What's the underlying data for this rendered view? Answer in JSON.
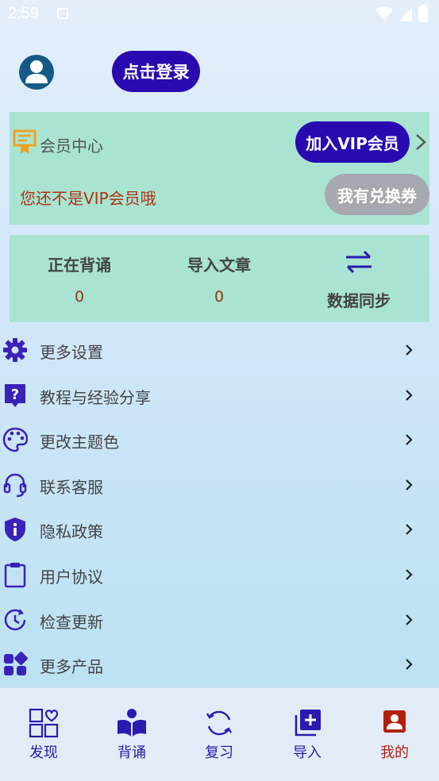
{
  "status_bar": {
    "time": "2:59"
  },
  "profile": {
    "login_label": "点击登录"
  },
  "vip": {
    "title": "会员中心",
    "join_label": "加入VIP会员",
    "status_text": "您还不是VIP会员哦",
    "coupon_label": "我有兑换券"
  },
  "stats": {
    "reciting": {
      "label": "正在背诵",
      "value": "0"
    },
    "imported": {
      "label": "导入文章",
      "value": "0"
    },
    "sync_label": "数据同步"
  },
  "menu": [
    {
      "label": "更多设置",
      "icon": "gear-icon"
    },
    {
      "label": "教程与经验分享",
      "icon": "help-icon"
    },
    {
      "label": "更改主题色",
      "icon": "palette-icon"
    },
    {
      "label": "联系客服",
      "icon": "headset-icon"
    },
    {
      "label": "隐私政策",
      "icon": "shield-info-icon"
    },
    {
      "label": "用户协议",
      "icon": "clipboard-icon"
    },
    {
      "label": "检查更新",
      "icon": "update-icon"
    },
    {
      "label": "更多产品",
      "icon": "apps-icon"
    }
  ],
  "nav": [
    {
      "label": "发现",
      "icon": "discover-icon",
      "active": false
    },
    {
      "label": "背诵",
      "icon": "book-icon",
      "active": false
    },
    {
      "label": "复习",
      "icon": "review-icon",
      "active": false
    },
    {
      "label": "导入",
      "icon": "import-icon",
      "active": false
    },
    {
      "label": "我的",
      "icon": "profile-icon",
      "active": true
    }
  ],
  "colors": {
    "accent": "#2a0ab0",
    "card": "#a9e4d3",
    "warning_text": "#b1320e",
    "active_tab": "#b1200c"
  }
}
